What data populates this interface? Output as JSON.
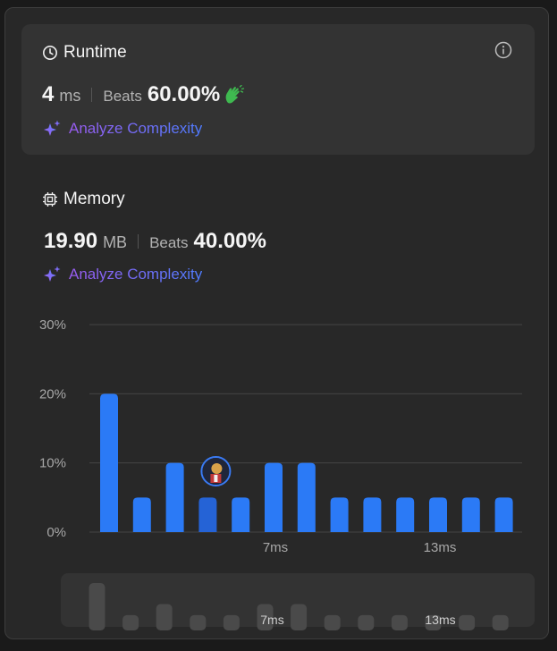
{
  "runtime": {
    "title": "Runtime",
    "value": "4",
    "unit": "ms",
    "beats_label": "Beats",
    "beats_pct": "60.00%",
    "analyze_label": "Analyze Complexity"
  },
  "memory": {
    "title": "Memory",
    "value": "19.90",
    "unit": "MB",
    "beats_label": "Beats",
    "beats_pct": "40.00%",
    "analyze_label": "Analyze Complexity"
  },
  "colors": {
    "bar": "#2b7af6",
    "bar_selected": "#2563d6",
    "clap": "#3fb950",
    "mini_bar": "#4a4a4a"
  },
  "chart_data": {
    "type": "bar",
    "yticks": [
      "30%",
      "20%",
      "10%",
      "0%"
    ],
    "ylim": [
      0,
      30
    ],
    "values": [
      20,
      5,
      10,
      5,
      5,
      10,
      10,
      5,
      5,
      5,
      5,
      5,
      5
    ],
    "selected_index": 3,
    "x_tick_labels": [
      {
        "index": 5,
        "label": "7ms"
      },
      {
        "index": 10,
        "label": "13ms"
      }
    ],
    "grid": true,
    "legend": "none"
  },
  "minimap": {
    "x_tick_labels": [
      {
        "index": 5,
        "label": "7ms"
      },
      {
        "index": 10,
        "label": "13ms"
      }
    ]
  },
  "icons": {
    "runtime": "clock-icon",
    "memory": "chip-icon",
    "info": "info-icon",
    "analyze": "sparkle-icon",
    "beats": "clapping-hands-icon",
    "user": "avatar"
  }
}
